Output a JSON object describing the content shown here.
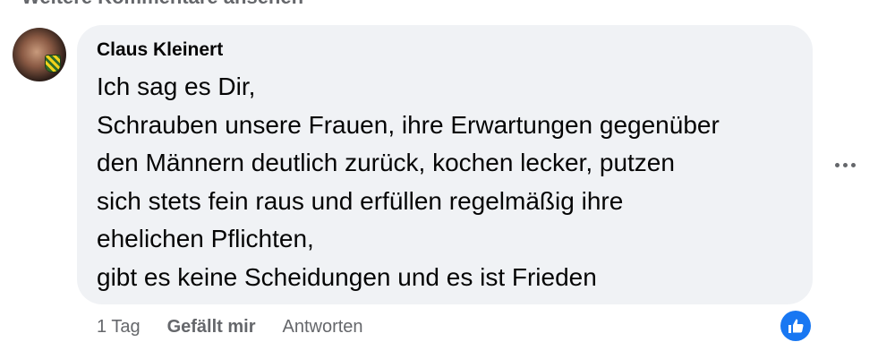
{
  "header": {
    "more_comments_label": "Weitere Kommentare ansehen"
  },
  "comment": {
    "author": "Claus Kleinert",
    "lines": [
      "Ich sag es Dir,",
      "Schrauben unsere Frauen, ihre Erwartungen gegenüber",
      "den Männern deutlich zurück, kochen lecker, putzen",
      "sich stets fein raus und erfüllen regelmäßig ihre",
      "ehelichen Pflichten,",
      "gibt es keine Scheidungen und es ist Frieden"
    ],
    "time": "1 Tag",
    "like_label": "Gefällt mir",
    "reply_label": "Antworten",
    "reaction_icon": "thumbs-up-icon",
    "reaction_color": "#1877f2"
  },
  "colors": {
    "bubble": "#f0f2f5",
    "secondary_text": "#65676b"
  }
}
